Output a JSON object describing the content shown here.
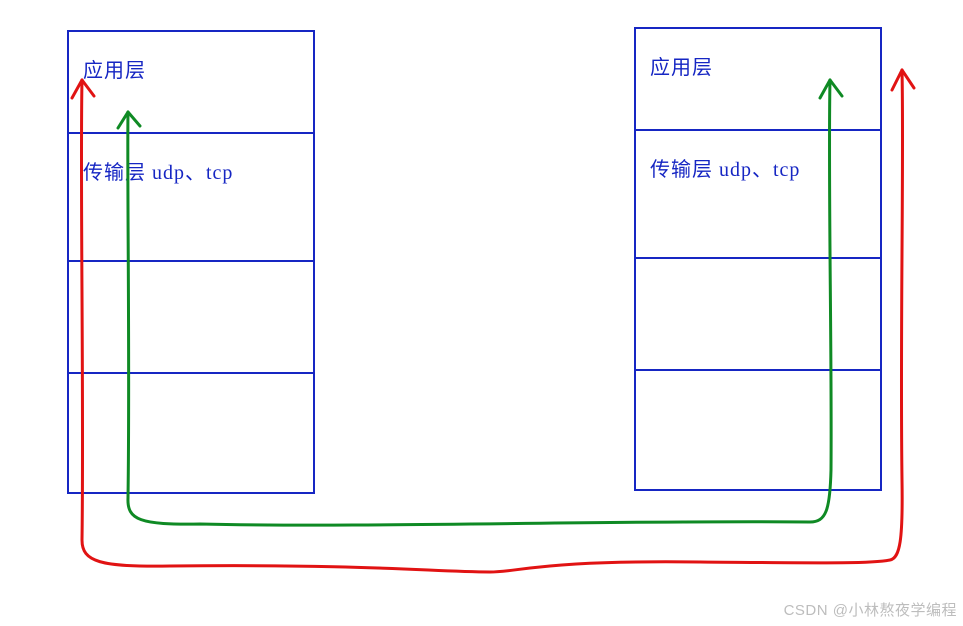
{
  "left_stack": {
    "rows": [
      {
        "label": "应用层"
      },
      {
        "label": "传输层 udp、tcp"
      },
      {
        "label": ""
      },
      {
        "label": ""
      }
    ]
  },
  "right_stack": {
    "rows": [
      {
        "label": "应用层"
      },
      {
        "label": "传输层 udp、tcp"
      },
      {
        "label": ""
      },
      {
        "label": ""
      }
    ]
  },
  "colors": {
    "box_border": "#1626c3",
    "text": "#1626c3",
    "green_arrow": "#0f8a24",
    "red_arrow": "#e11313"
  },
  "watermark": "CSDN @小林熬夜学编程"
}
